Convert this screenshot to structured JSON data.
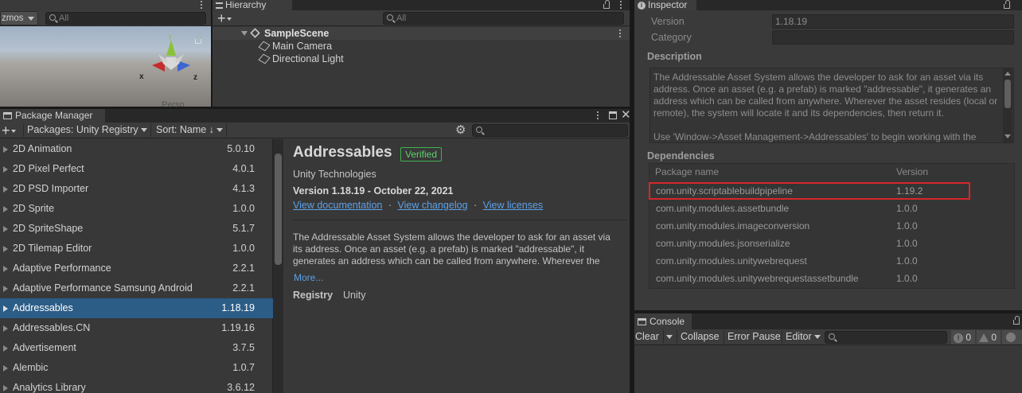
{
  "scene_view": {
    "gizmos_label": "zmos",
    "search_placeholder": "All",
    "axis_x": "x",
    "axis_z": "z",
    "persp_label": "Persp"
  },
  "hierarchy": {
    "tab_label": "Hierarchy",
    "search_placeholder": "All",
    "scene_name": "SampleScene",
    "objects": [
      "Main Camera",
      "Directional Light"
    ]
  },
  "inspector": {
    "tab_label": "Inspector",
    "version_label": "Version",
    "version_value": "1.18.19",
    "category_label": "Category",
    "category_value": "",
    "description_header": "Description",
    "description_text": "The Addressable Asset System allows the developer to ask for an asset via its address. Once an asset (e.g. a prefab) is marked \"addressable\", it generates an address which can be called from anywhere. Wherever the asset resides (local or remote), the system will locate it and its dependencies, then return it.",
    "description_text_2": "Use 'Window->Asset Management->Addressables' to begin working with the",
    "dependencies_header": "Dependencies",
    "dep_col_name": "Package name",
    "dep_col_version": "Version",
    "dependencies": [
      {
        "name": "com.unity.scriptablebuildpipeline",
        "version": "1.19.2"
      },
      {
        "name": "com.unity.modules.assetbundle",
        "version": "1.0.0"
      },
      {
        "name": "com.unity.modules.imageconversion",
        "version": "1.0.0"
      },
      {
        "name": "com.unity.modules.jsonserialize",
        "version": "1.0.0"
      },
      {
        "name": "com.unity.modules.unitywebrequest",
        "version": "1.0.0"
      },
      {
        "name": "com.unity.modules.unitywebrequestassetbundle",
        "version": "1.0.0"
      }
    ],
    "highlight_color": "#d8262a"
  },
  "package_manager": {
    "tab_label": "Package Manager",
    "add_label": "+",
    "registry_dropdown": "Packages: Unity Registry",
    "sort_dropdown": "Sort: Name ↓",
    "packages": [
      {
        "name": "2D Animation",
        "version": "5.0.10"
      },
      {
        "name": "2D Pixel Perfect",
        "version": "4.0.1"
      },
      {
        "name": "2D PSD Importer",
        "version": "4.1.3"
      },
      {
        "name": "2D Sprite",
        "version": "1.0.0"
      },
      {
        "name": "2D SpriteShape",
        "version": "5.1.7"
      },
      {
        "name": "2D Tilemap Editor",
        "version": "1.0.0"
      },
      {
        "name": "Adaptive Performance",
        "version": "2.2.1"
      },
      {
        "name": "Adaptive Performance Samsung Android",
        "version": "2.2.1"
      },
      {
        "name": "Addressables",
        "version": "1.18.19"
      },
      {
        "name": "Addressables.CN",
        "version": "1.19.16"
      },
      {
        "name": "Advertisement",
        "version": "3.7.5"
      },
      {
        "name": "Alembic",
        "version": "1.0.7"
      },
      {
        "name": "Analytics Library",
        "version": "3.6.12"
      }
    ],
    "selected_index": 8,
    "selected_color": "#2c5d87",
    "detail": {
      "title": "Addressables",
      "badge": "Verified",
      "author": "Unity Technologies",
      "version_line": "Version 1.18.19 - October 22, 2021",
      "link_docs": "View documentation",
      "link_changelog": "View changelog",
      "link_licenses": "View licenses",
      "separator": "·",
      "description": "The Addressable Asset System allows the developer to ask for an asset via its address. Once an asset (e.g. a prefab) is marked \"addressable\", it generates an address which can be called from anywhere. Wherever the",
      "more_link": "More...",
      "registry_label": "Registry",
      "registry_value": "Unity"
    }
  },
  "console": {
    "tab_label": "Console",
    "clear": "Clear",
    "collapse": "Collapse",
    "error_pause": "Error Pause",
    "editor": "Editor",
    "info_count": "0",
    "warn_count": "0"
  }
}
